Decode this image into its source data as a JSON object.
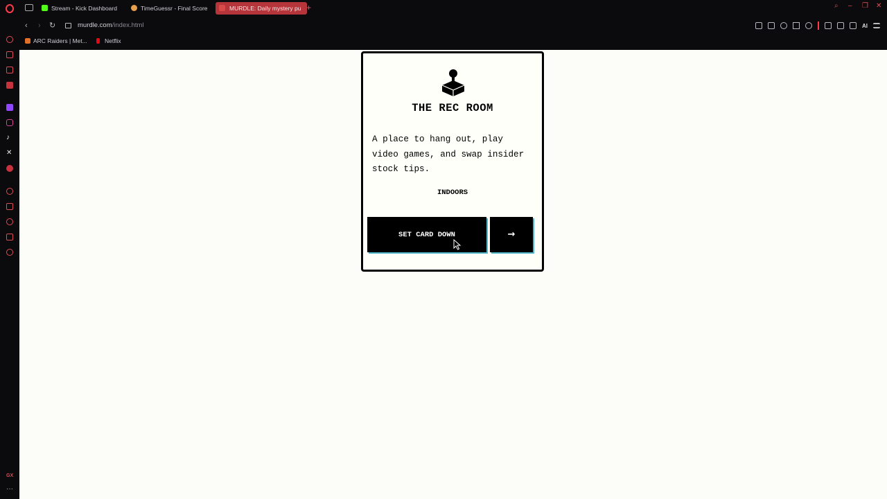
{
  "browser": {
    "tabs": [
      {
        "label": "Stream - Kick Dashboard",
        "favicon_color": "#53fc18"
      },
      {
        "label": "TimeGuessr - Final Score",
        "favicon_color": "#e8a14a"
      },
      {
        "label": "MURDLE: Daily mystery pu",
        "favicon_color": "#d84a4a",
        "active": true
      }
    ],
    "url_host": "murdle.com",
    "url_path": "/index.html",
    "toolbar_ai_label": "AI",
    "bookmarks": [
      {
        "label": "ARC Raiders | Met...",
        "favicon_color": "#e0702a"
      },
      {
        "label": "Netflix",
        "favicon_color": "#e50914"
      }
    ],
    "accent_color": "#ff3b4a"
  },
  "card": {
    "icon": "rec-room-joystick-icon",
    "title": "THE REC ROOM",
    "description": "A place to hang out, play video games, and swap insider stock tips.",
    "tag": "INDOORS",
    "primary_button": "SET CARD DOWN",
    "next_button": "→",
    "button_shadow_color": "#4fb6c8"
  }
}
